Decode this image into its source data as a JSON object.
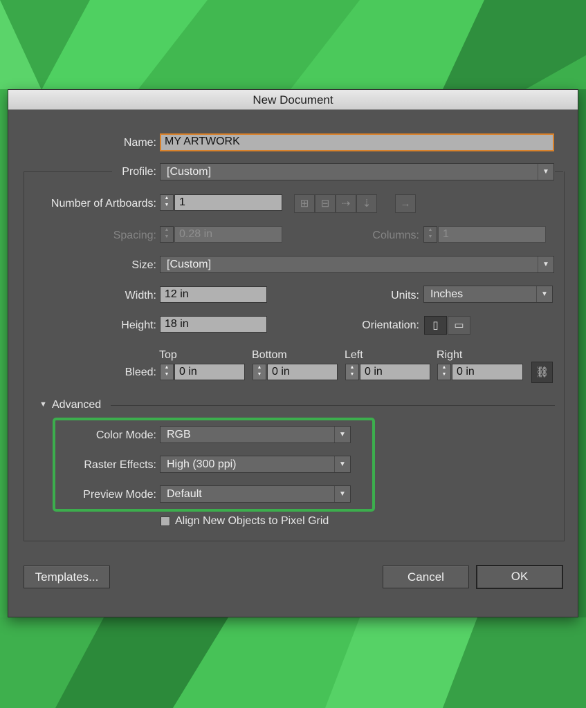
{
  "dialog": {
    "title": "New Document"
  },
  "name": {
    "label": "Name:",
    "value": "MY ARTWORK"
  },
  "profile": {
    "label": "Profile:",
    "value": "[Custom]"
  },
  "artboards": {
    "label": "Number of Artboards:",
    "value": "1"
  },
  "spacing": {
    "label": "Spacing:",
    "value": "0.28 in"
  },
  "columns": {
    "label": "Columns:",
    "value": "1"
  },
  "size": {
    "label": "Size:",
    "value": "[Custom]"
  },
  "width": {
    "label": "Width:",
    "value": "12 in"
  },
  "units": {
    "label": "Units:",
    "value": "Inches"
  },
  "height": {
    "label": "Height:",
    "value": "18 in"
  },
  "orientation": {
    "label": "Orientation:"
  },
  "bleed": {
    "label": "Bleed:",
    "top": {
      "label": "Top",
      "value": "0 in"
    },
    "bottom": {
      "label": "Bottom",
      "value": "0 in"
    },
    "left": {
      "label": "Left",
      "value": "0 in"
    },
    "right": {
      "label": "Right",
      "value": "0 in"
    }
  },
  "advanced": {
    "label": "Advanced",
    "color_mode": {
      "label": "Color Mode:",
      "value": "RGB"
    },
    "raster_effects": {
      "label": "Raster Effects:",
      "value": "High (300 ppi)"
    },
    "preview_mode": {
      "label": "Preview Mode:",
      "value": "Default"
    },
    "align_pixel_grid": {
      "label": "Align New Objects to Pixel Grid",
      "checked": false
    }
  },
  "buttons": {
    "templates": "Templates...",
    "cancel": "Cancel",
    "ok": "OK"
  },
  "colors": {
    "highlight": "#3cae4d",
    "dialog_bg": "#535353",
    "field_bg": "#b1b1b1",
    "focus_border": "#d9822b",
    "background_green": "#45c154"
  }
}
